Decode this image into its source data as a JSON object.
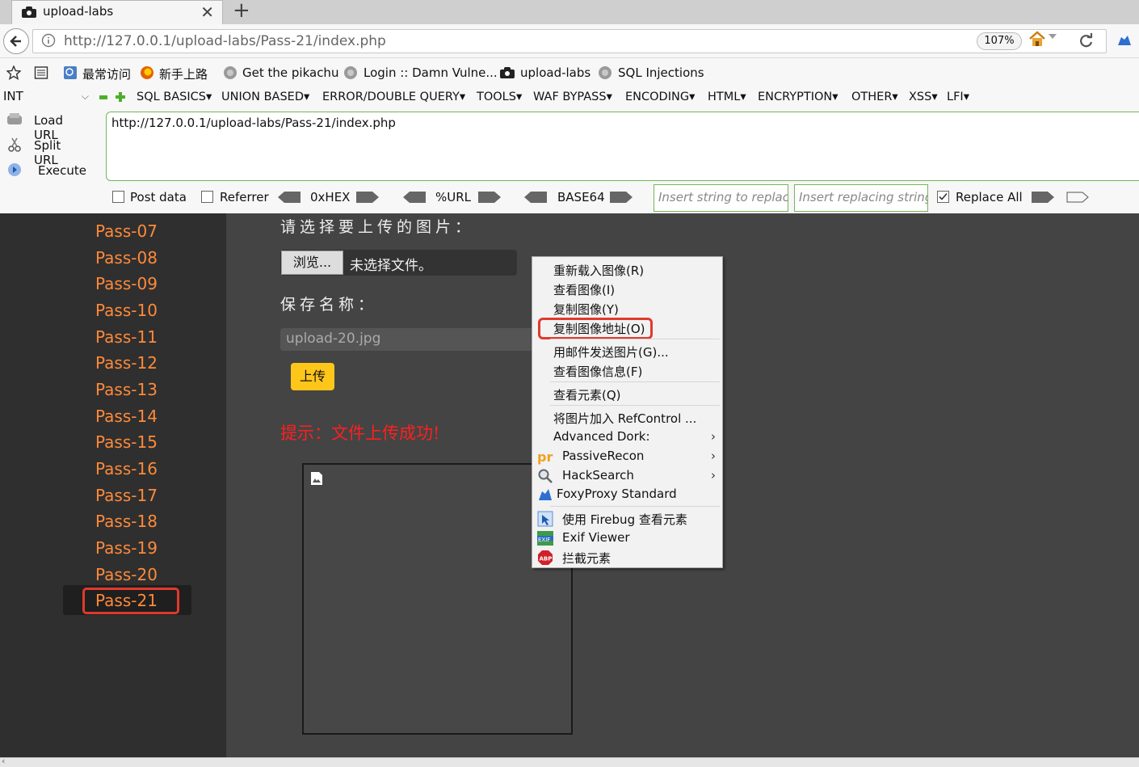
{
  "browser": {
    "tab_title": "upload-labs",
    "tab_close": "✕",
    "new_tab": "+",
    "url": "http://127.0.0.1/upload-labs/Pass-21/index.php",
    "zoom": "107%"
  },
  "bookmarks": [
    {
      "label": "最常访问",
      "icon": "bookmark-icon"
    },
    {
      "label": "新手上路",
      "icon": "firefox-icon"
    },
    {
      "label": "Get the pikachu",
      "icon": "globe-icon"
    },
    {
      "label": "Login :: Damn Vulne...",
      "icon": "globe-icon"
    },
    {
      "label": "upload-labs",
      "icon": "site-icon"
    },
    {
      "label": "SQL Injections",
      "icon": "globe-icon"
    }
  ],
  "hackbar": {
    "type_select": "INT",
    "menus": [
      "SQL BASICS",
      "UNION BASED",
      "ERROR/DOUBLE QUERY",
      "TOOLS",
      "WAF BYPASS",
      "ENCODING",
      "HTML",
      "ENCRYPTION",
      "OTHER",
      "XSS",
      "LFI"
    ],
    "load_url": "Load URL",
    "split_url": "Split URL",
    "execute": "Execute",
    "url_value": "http://127.0.0.1/upload-labs/Pass-21/index.php",
    "post_data": "Post data",
    "referrer": "Referrer",
    "enc_hex": "0xHEX",
    "enc_url": "%URL",
    "enc_b64": "BASE64",
    "replace_placeholder": "Insert string to replace",
    "replacing_placeholder": "Insert replacing string",
    "replace_all": "Replace All",
    "replace_all_checked": true
  },
  "sidebar": {
    "passes": [
      "Pass-07",
      "Pass-08",
      "Pass-09",
      "Pass-10",
      "Pass-11",
      "Pass-12",
      "Pass-13",
      "Pass-14",
      "Pass-15",
      "Pass-16",
      "Pass-17",
      "Pass-18",
      "Pass-19",
      "Pass-20",
      "Pass-21"
    ],
    "active": "Pass-21"
  },
  "main": {
    "select_label": "请选择要上传的图片：",
    "browse_button": "浏览...",
    "no_file": "未选择文件。",
    "save_label": "保存名称：",
    "save_name": "upload-20.jpg",
    "upload_button": "上传",
    "tip": "提示：文件上传成功!"
  },
  "context_menu": {
    "items": [
      "重新载入图像(R)",
      "查看图像(I)",
      "复制图像(Y)",
      "复制图像地址(O)",
      "用邮件发送图片(G)...",
      "查看图像信息(F)",
      "查看元素(Q)",
      "将图片加入 RefControl ...",
      "Advanced Dork:",
      "PassiveRecon",
      "HackSearch",
      "FoxyProxy Standard",
      "使用 Firebug 查看元素",
      "Exif Viewer",
      "拦截元素"
    ],
    "highlighted": "复制图像地址(O)",
    "submenu_arrow": "›"
  },
  "colors": {
    "pass_link": "#ff8a3a",
    "tip": "#ff1f1f",
    "upload_button": "#ffc61a",
    "highlight": "#e03a2c",
    "hackbar_border": "#74b55d"
  }
}
